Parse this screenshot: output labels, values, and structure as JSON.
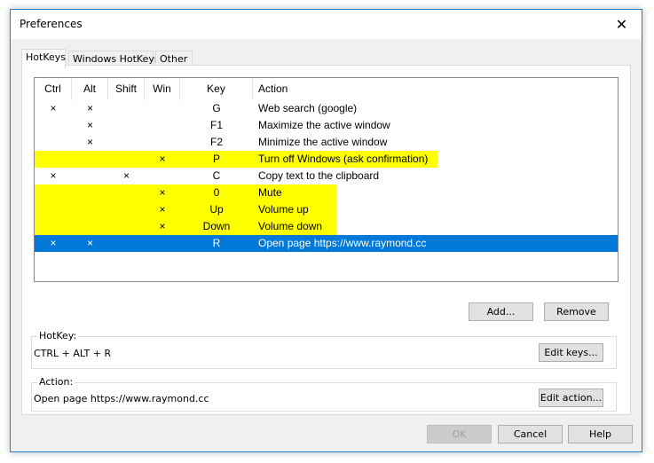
{
  "window": {
    "title": "Preferences",
    "close_glyph": "✕"
  },
  "tabs": [
    {
      "label": "HotKeys",
      "active": true
    },
    {
      "label": "Windows HotKeys",
      "active": false
    },
    {
      "label": "Other",
      "active": false
    }
  ],
  "table": {
    "headers": [
      "Ctrl",
      "Alt",
      "Shift",
      "Win",
      "Key",
      "Action"
    ],
    "rows": [
      {
        "ctrl": "×",
        "alt": "×",
        "shift": "",
        "win": "",
        "key": "G",
        "action": "Web search (google)",
        "highlight": false,
        "selected": false
      },
      {
        "ctrl": "",
        "alt": "×",
        "shift": "",
        "win": "",
        "key": "F1",
        "action": "Maximize the active window",
        "highlight": false,
        "selected": false
      },
      {
        "ctrl": "",
        "alt": "×",
        "shift": "",
        "win": "",
        "key": "F2",
        "action": "Minimize the active window",
        "highlight": false,
        "selected": false
      },
      {
        "ctrl": "",
        "alt": "",
        "shift": "",
        "win": "×",
        "key": "P",
        "action": "Turn off Windows (ask confirmation)",
        "highlight": true,
        "selected": false
      },
      {
        "ctrl": "×",
        "alt": "",
        "shift": "×",
        "win": "",
        "key": "C",
        "action": "Copy text to the clipboard",
        "highlight": false,
        "selected": false
      },
      {
        "ctrl": "",
        "alt": "",
        "shift": "",
        "win": "×",
        "key": "0",
        "action": "Mute",
        "highlight": true,
        "selected": false
      },
      {
        "ctrl": "",
        "alt": "",
        "shift": "",
        "win": "×",
        "key": "Up",
        "action": "Volume up",
        "highlight": true,
        "selected": false
      },
      {
        "ctrl": "",
        "alt": "",
        "shift": "",
        "win": "×",
        "key": "Down",
        "action": "Volume down",
        "highlight": true,
        "selected": false
      },
      {
        "ctrl": "×",
        "alt": "×",
        "shift": "",
        "win": "",
        "key": "R",
        "action": "Open page https://www.raymond.cc",
        "highlight": false,
        "selected": true
      }
    ]
  },
  "buttons": {
    "add": "Add...",
    "remove": "Remove",
    "edit_keys": "Edit keys...",
    "edit_action": "Edit action...",
    "ok": "OK",
    "cancel": "Cancel",
    "help": "Help"
  },
  "hotkey_group": {
    "label": "HotKey:",
    "value": "CTRL + ALT + R"
  },
  "action_group": {
    "label": "Action:",
    "value": "Open page https://www.raymond.cc"
  },
  "colors": {
    "highlight": "#ffff00",
    "selected": "#0078d7",
    "border_accent": "#1883d7"
  }
}
